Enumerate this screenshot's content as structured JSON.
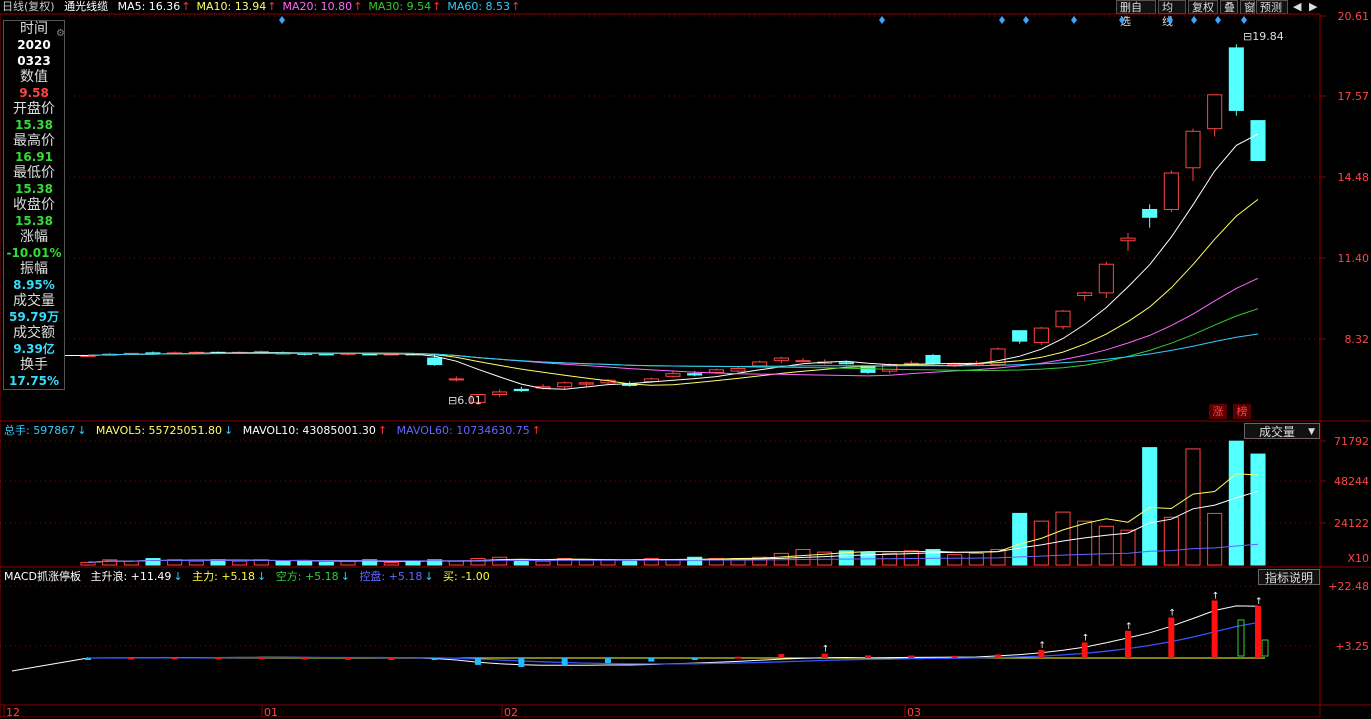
{
  "header": {
    "period": "日线(复权)",
    "stock_name": "通光线缆",
    "ma": [
      {
        "label": "MA5: 16.36",
        "arrow": "↑",
        "color": "#ffffff",
        "arrow_color": "#ff3333"
      },
      {
        "label": "MA10: 13.94",
        "arrow": "↑",
        "color": "#ffff66",
        "arrow_color": "#ff3333"
      },
      {
        "label": "MA20: 10.80",
        "arrow": "↑",
        "color": "#ff66ff",
        "arrow_color": "#ff3333"
      },
      {
        "label": "MA30: 9.54",
        "arrow": "↑",
        "color": "#33cc33",
        "arrow_color": "#ff3333"
      },
      {
        "label": "MA60: 8.53",
        "arrow": "↑",
        "color": "#33ccff",
        "arrow_color": "#ff3333"
      }
    ],
    "buttons": [
      "删自选",
      "均线",
      "复权",
      "叠",
      "窗",
      "预测"
    ]
  },
  "info_panel": {
    "time_label": "时间",
    "year": "2020",
    "date": "0323",
    "value_label": "数值",
    "value": "9.58",
    "open_label": "开盘价",
    "open": "15.38",
    "high_label": "最高价",
    "high": "16.91",
    "low_label": "最低价",
    "low": "15.38",
    "close_label": "收盘价",
    "close": "15.38",
    "change_label": "涨幅",
    "change": "-10.01%",
    "amplitude_label": "振幅",
    "amplitude": "8.95%",
    "volume_label": "成交量",
    "volume": "59.79万",
    "turnover_label": "成交额",
    "turnover": "9.39亿",
    "hand_label": "换手",
    "hand": "17.75%"
  },
  "price_axis": [
    "20.61",
    "17.57",
    "14.48",
    "11.40",
    "8.32"
  ],
  "annotations": {
    "high": "19.84",
    "low": "6.01",
    "zhang": "涨",
    "bang": "榜"
  },
  "volume_legend": {
    "total": "总手: 597867",
    "mavol5": "MAVOL5: 55725051.80",
    "mavol10": "MAVOL10: 43085001.30",
    "mavol60": "MAVOL60: 10734630.75",
    "dropdown": "成交量"
  },
  "volume_axis": [
    "71792",
    "48244",
    "24122",
    "X10"
  ],
  "macd_legend": {
    "name": "MACD抓涨停板",
    "zsl": "主升浪: +11.49",
    "zl": "主力: +5.18",
    "kf": "空方: +5.18",
    "kp": "控盘: +5.18",
    "buy": "买: -1.00",
    "button": "指标说明"
  },
  "macd_axis": [
    "+22.48",
    "+3.25"
  ],
  "date_axis": [
    "12",
    "01",
    "02",
    "03"
  ],
  "chart_data": {
    "type": "candlestick",
    "candles": [
      [
        7.9,
        7.9,
        7.9,
        7.9
      ],
      [
        7.95,
        8.0,
        7.9,
        7.95
      ],
      [
        7.95,
        8.0,
        7.92,
        7.98
      ],
      [
        8.0,
        8.05,
        7.95,
        7.98
      ],
      [
        7.98,
        8.05,
        7.95,
        8.0
      ],
      [
        8.0,
        8.05,
        7.95,
        8.02
      ],
      [
        8.02,
        8.05,
        7.95,
        7.98
      ],
      [
        8.0,
        8.05,
        7.95,
        8.02
      ],
      [
        8.02,
        8.1,
        7.95,
        8.05
      ],
      [
        8.0,
        8.05,
        7.95,
        7.98
      ],
      [
        7.98,
        8.02,
        7.9,
        7.96
      ],
      [
        7.96,
        8.0,
        7.9,
        7.95
      ],
      [
        7.95,
        8.0,
        7.9,
        7.98
      ],
      [
        7.96,
        8.0,
        7.9,
        7.95
      ],
      [
        7.95,
        8.0,
        7.9,
        7.96
      ],
      [
        7.96,
        8.0,
        7.9,
        7.94
      ],
      [
        7.8,
        7.95,
        7.5,
        7.55
      ],
      [
        7.0,
        7.1,
        6.9,
        7.0
      ],
      [
        6.1,
        6.4,
        6.01,
        6.4
      ],
      [
        6.4,
        6.6,
        6.3,
        6.5
      ],
      [
        6.6,
        6.7,
        6.5,
        6.55
      ],
      [
        6.65,
        6.8,
        6.6,
        6.7
      ],
      [
        6.7,
        6.9,
        6.6,
        6.85
      ],
      [
        6.8,
        6.9,
        6.7,
        6.85
      ],
      [
        6.85,
        7.0,
        6.8,
        6.95
      ],
      [
        6.8,
        6.9,
        6.7,
        6.75
      ],
      [
        6.9,
        7.05,
        6.85,
        7.0
      ],
      [
        7.1,
        7.3,
        7.05,
        7.2
      ],
      [
        7.2,
        7.3,
        7.1,
        7.15
      ],
      [
        7.25,
        7.4,
        7.2,
        7.35
      ],
      [
        7.3,
        7.45,
        7.25,
        7.4
      ],
      [
        7.5,
        7.7,
        7.45,
        7.65
      ],
      [
        7.7,
        7.85,
        7.6,
        7.8
      ],
      [
        7.7,
        7.8,
        7.65,
        7.7
      ],
      [
        7.6,
        7.75,
        7.55,
        7.65
      ],
      [
        7.62,
        7.7,
        7.55,
        7.6
      ],
      [
        7.5,
        7.5,
        7.2,
        7.25
      ],
      [
        7.3,
        7.6,
        7.2,
        7.55
      ],
      [
        7.6,
        7.7,
        7.5,
        7.6
      ],
      [
        7.9,
        7.95,
        7.55,
        7.6
      ],
      [
        7.5,
        7.6,
        7.45,
        7.55
      ],
      [
        7.6,
        7.7,
        7.5,
        7.6
      ],
      [
        7.55,
        8.2,
        7.5,
        8.15
      ],
      [
        8.85,
        8.85,
        8.35,
        8.45
      ],
      [
        8.4,
        9.0,
        8.3,
        8.95
      ],
      [
        9.0,
        9.65,
        8.9,
        9.6
      ],
      [
        10.2,
        10.35,
        10.0,
        10.3
      ],
      [
        10.3,
        11.5,
        10.1,
        11.4
      ],
      [
        12.3,
        12.6,
        11.9,
        12.4
      ],
      [
        13.5,
        13.7,
        12.8,
        13.2
      ],
      [
        13.5,
        15.0,
        13.4,
        14.9
      ],
      [
        15.1,
        16.6,
        14.6,
        16.5
      ],
      [
        16.6,
        17.9,
        16.3,
        17.9
      ],
      [
        19.7,
        19.84,
        17.1,
        17.3
      ],
      [
        16.91,
        16.91,
        15.38,
        15.38
      ]
    ],
    "volumes": [
      2,
      4,
      3,
      5,
      4,
      3,
      4,
      3,
      4,
      3,
      3,
      2,
      3,
      4,
      2,
      3,
      4,
      3,
      5,
      6,
      4,
      3,
      5,
      4,
      4,
      3,
      5,
      4,
      6,
      5,
      5,
      6,
      9,
      12,
      10,
      11,
      10,
      9,
      11,
      12,
      8,
      9,
      12,
      40,
      34,
      41,
      34,
      30,
      27,
      91,
      37,
      90,
      40,
      96,
      86
    ],
    "ylim": [
      5.5,
      21
    ]
  }
}
